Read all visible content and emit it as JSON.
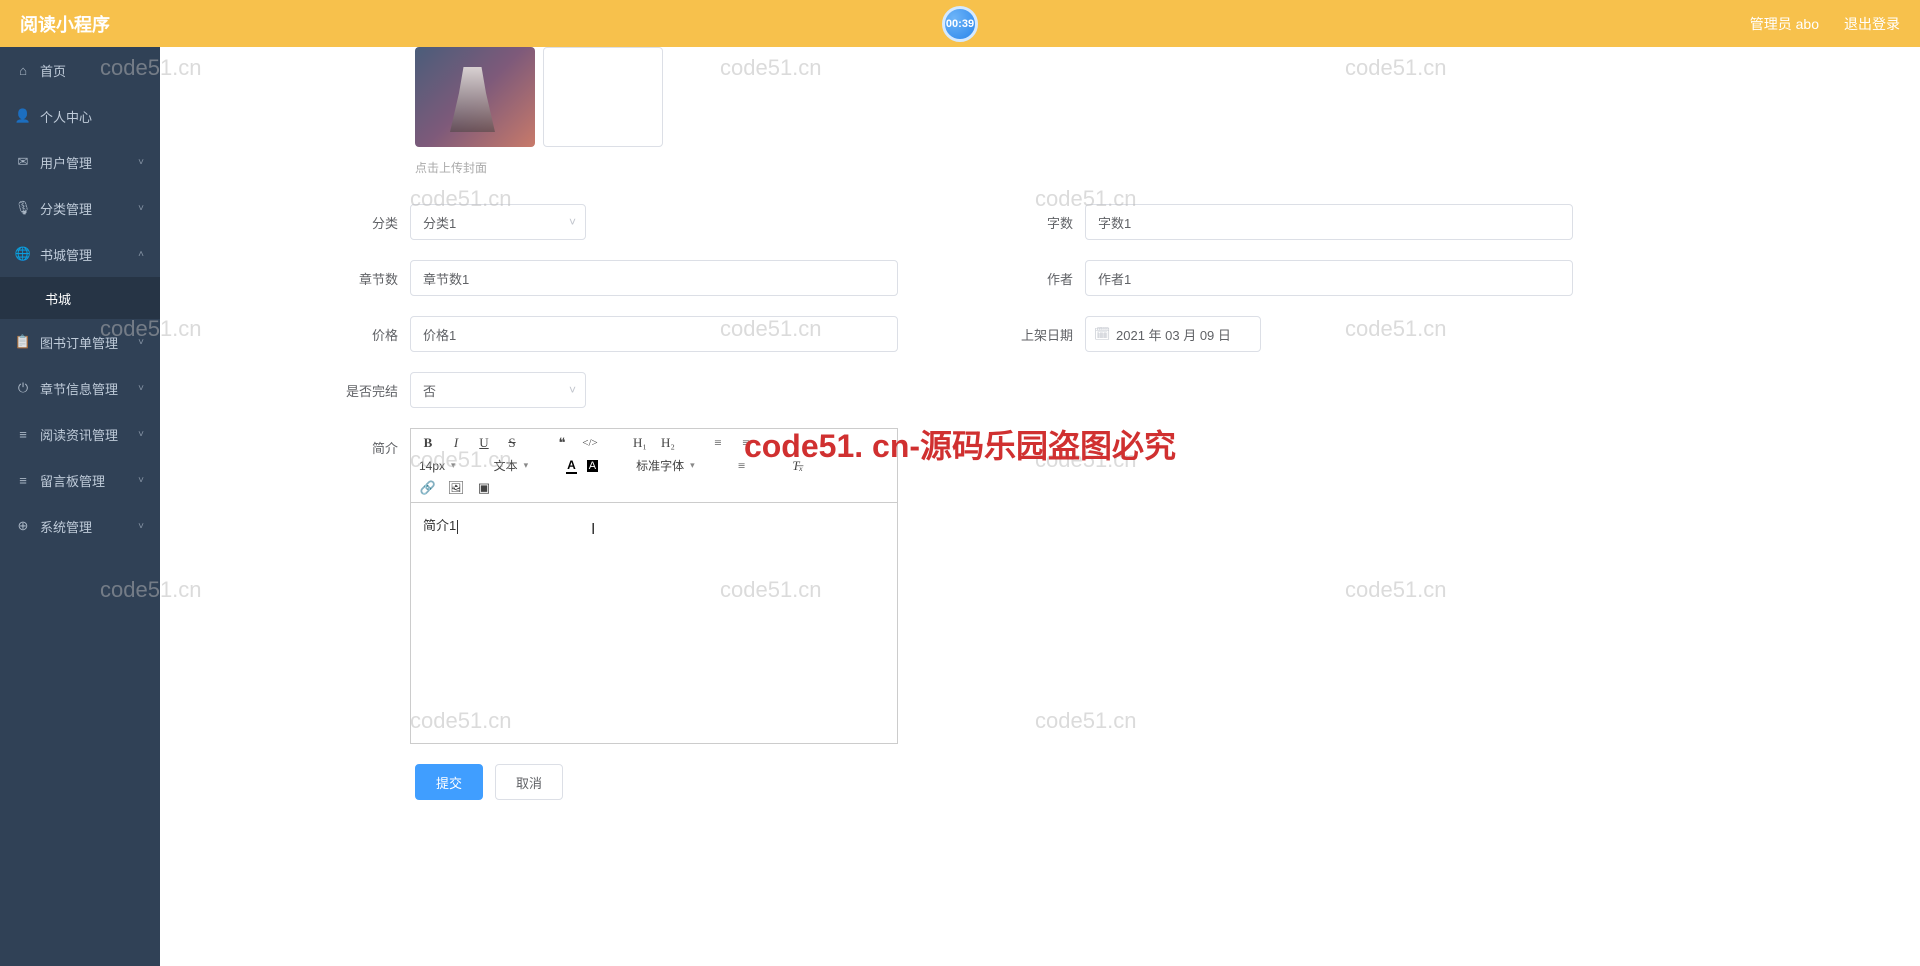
{
  "header": {
    "title": "阅读小程序",
    "admin": "管理员 abo",
    "logout": "退出登录"
  },
  "badge": "00:39",
  "sidebar": {
    "items": [
      {
        "label": "首页",
        "icon": "⌂"
      },
      {
        "label": "个人中心",
        "icon": "👤"
      },
      {
        "label": "用户管理",
        "icon": "✉",
        "arrow": "˅"
      },
      {
        "label": "分类管理",
        "icon": "🎙",
        "arrow": "˅"
      },
      {
        "label": "书城管理",
        "icon": "🌐",
        "arrow": "˄"
      },
      {
        "label": "图书订单管理",
        "icon": "📋",
        "arrow": "˅"
      },
      {
        "label": "章节信息管理",
        "icon": "⏻",
        "arrow": "˅"
      },
      {
        "label": "阅读资讯管理",
        "icon": "≡",
        "arrow": "˅"
      },
      {
        "label": "留言板管理",
        "icon": "≡",
        "arrow": "˅"
      },
      {
        "label": "系统管理",
        "icon": "⊕",
        "arrow": "˅"
      }
    ],
    "subitem": "书城"
  },
  "form": {
    "upload_hint": "点击上传封面",
    "category_label": "分类",
    "category_value": "分类1",
    "wordcount_label": "字数",
    "wordcount_value": "字数1",
    "chapters_label": "章节数",
    "chapters_value": "章节数1",
    "author_label": "作者",
    "author_value": "作者1",
    "price_label": "价格",
    "price_value": "价格1",
    "listdate_label": "上架日期",
    "listdate_value": "2021 年 03 月 09 日",
    "finished_label": "是否完结",
    "finished_value": "否",
    "intro_label": "简介",
    "intro_value": "简介1"
  },
  "editor": {
    "bold": "B",
    "italic": "I",
    "underline": "U",
    "strike": "S",
    "quote": "❝",
    "code": "</>",
    "h1": "H₁",
    "h2": "H₂",
    "ol": "≡",
    "ul": "≡",
    "fontsize": "14px",
    "text_label": "文本",
    "font_family": "标准字体",
    "link": "🔗",
    "image": "🖼",
    "clean": "⌫"
  },
  "buttons": {
    "submit": "提交",
    "cancel": "取消"
  },
  "watermark": "code51.cn",
  "watermark_big": "code51. cn-源码乐园盗图必究"
}
